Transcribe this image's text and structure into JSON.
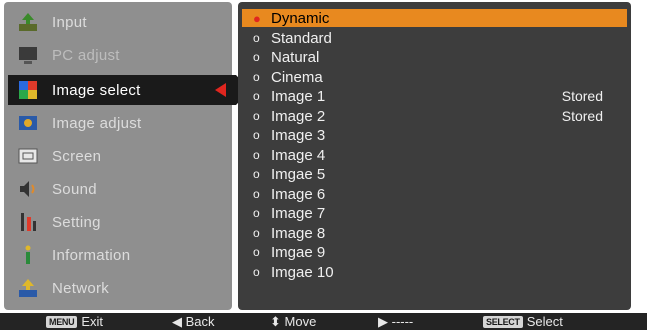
{
  "menu": {
    "items": [
      {
        "label": "Input",
        "icon": "input-icon"
      },
      {
        "label": "PC adjust",
        "icon": "monitor-icon"
      },
      {
        "label": "Image select",
        "icon": "image-select-icon"
      },
      {
        "label": "Image adjust",
        "icon": "image-adjust-icon"
      },
      {
        "label": "Screen",
        "icon": "screen-icon"
      },
      {
        "label": "Sound",
        "icon": "sound-icon"
      },
      {
        "label": "Setting",
        "icon": "setting-icon"
      },
      {
        "label": "Information",
        "icon": "information-icon"
      },
      {
        "label": "Network",
        "icon": "network-icon"
      }
    ],
    "selected_index": 2
  },
  "image_modes": {
    "items": [
      {
        "label": "Dynamic",
        "status": ""
      },
      {
        "label": "Standard",
        "status": ""
      },
      {
        "label": "Natural",
        "status": ""
      },
      {
        "label": "Cinema",
        "status": ""
      },
      {
        "label": "Image 1",
        "status": "Stored"
      },
      {
        "label": "Image 2",
        "status": "Stored"
      },
      {
        "label": "Image 3",
        "status": ""
      },
      {
        "label": "Image 4",
        "status": ""
      },
      {
        "label": "Imgae 5",
        "status": ""
      },
      {
        "label": "Image 6",
        "status": ""
      },
      {
        "label": "Image 7",
        "status": ""
      },
      {
        "label": "Image 8",
        "status": ""
      },
      {
        "label": "Imgae 9",
        "status": ""
      },
      {
        "label": "Imgae 10",
        "status": ""
      }
    ],
    "selected_index": 0,
    "bullet": "o"
  },
  "help_bar": {
    "exit_key": "MENU",
    "exit_label": "Exit",
    "back_label": "◀ Back",
    "move_label": "⬍ Move",
    "next_label": "▶ -----",
    "select_key": "SELECT",
    "select_label": "Select"
  },
  "colors": {
    "highlight": "#e8891f",
    "arrow": "#e0261f",
    "panel_left": "#8f8f8f",
    "panel_right": "#3d3d3d"
  }
}
